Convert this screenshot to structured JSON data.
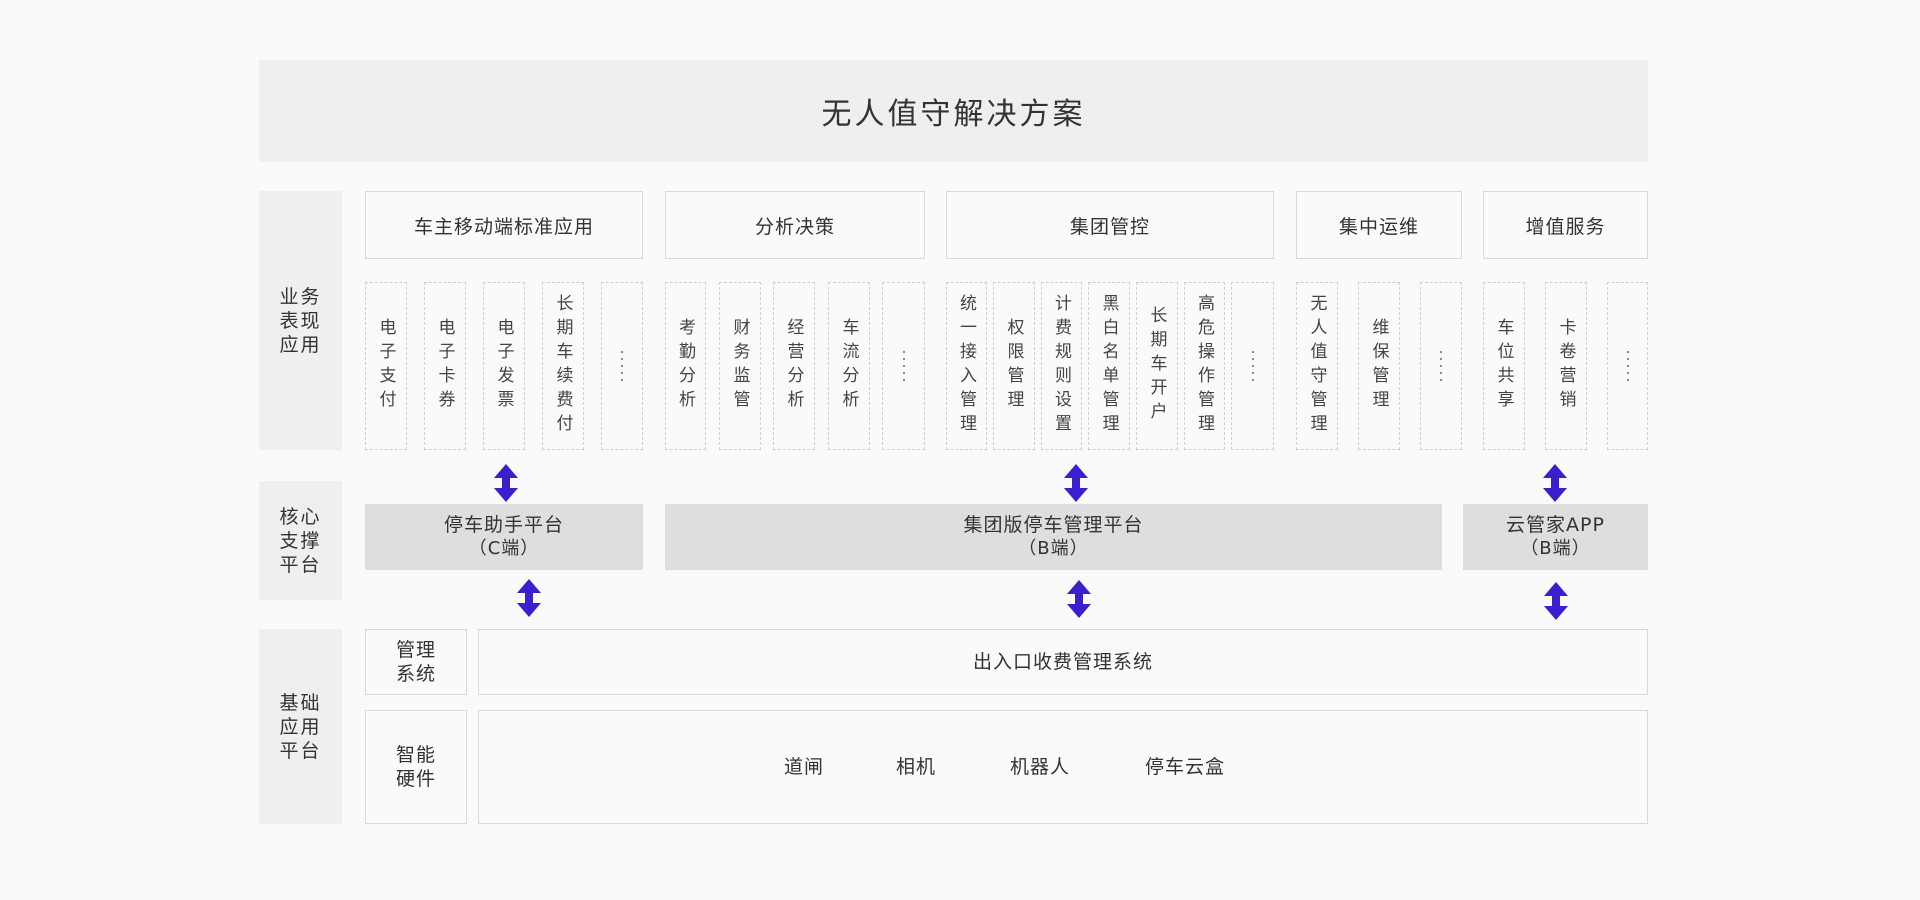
{
  "title": "无人值守解决方案",
  "rows": {
    "business": "业务\n表现\n应用",
    "core": "核心\n支撑\n平台",
    "base": "基础\n应用\n平台"
  },
  "categories": [
    {
      "label": "车主移动端标准应用",
      "items": [
        "电子支付",
        "电子卡券",
        "电子发票",
        "长期车续费付",
        "…"
      ]
    },
    {
      "label": "分析决策",
      "items": [
        "考勤分析",
        "财务监管",
        "经营分析",
        "车流分析",
        "…"
      ]
    },
    {
      "label": "集团管控",
      "items": [
        "统一接入管理",
        "权限管理",
        "计费规则设置",
        "黑白名单管理",
        "长期车开户",
        "高危操作管理",
        "…"
      ]
    },
    {
      "label": "集中运维",
      "items": [
        "无人值守管理",
        "维保管理",
        "…"
      ]
    },
    {
      "label": "增值服务",
      "items": [
        "车位共享",
        "卡卷营销",
        "…"
      ]
    }
  ],
  "platforms": [
    {
      "name": "停车助手平台",
      "sub": "（C端）"
    },
    {
      "name": "集团版停车管理平台",
      "sub": "（B端）"
    },
    {
      "name": "云管家APP",
      "sub": "（B端）"
    }
  ],
  "base": {
    "mgmt_label": "管理\n系统",
    "mgmt_system": "出入口收费管理系统",
    "hw_label": "智能\n硬件",
    "hardware": [
      "道闸",
      "相机",
      "机器人",
      "停车云盒"
    ]
  },
  "colors": {
    "arrow": "#3a1fd0",
    "panel": "#efefef",
    "platform": "#dedede"
  }
}
